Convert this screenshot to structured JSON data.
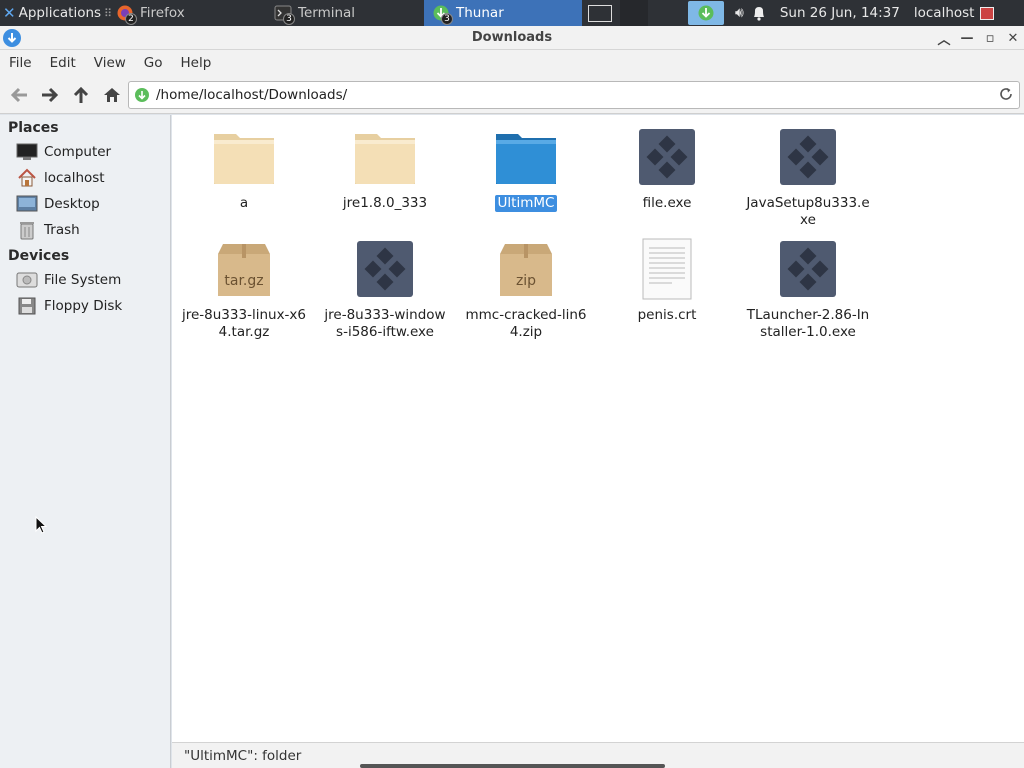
{
  "panel": {
    "apps_label": "Applications",
    "tasks": [
      {
        "label": "Firefox",
        "badge": "2",
        "active": false
      },
      {
        "label": "Terminal",
        "badge": "3",
        "active": false
      },
      {
        "label": "Thunar",
        "badge": "3",
        "active": true
      }
    ],
    "clock": "Sun 26 Jun, 14:37",
    "user": "localhost"
  },
  "window": {
    "title": "Downloads"
  },
  "menu": [
    "File",
    "Edit",
    "View",
    "Go",
    "Help"
  ],
  "location": {
    "path": "/home/localhost/Downloads/"
  },
  "sidebar": {
    "places_heading": "Places",
    "places": [
      {
        "label": "Computer",
        "icon": "monitor-icon"
      },
      {
        "label": "localhost",
        "icon": "home-icon"
      },
      {
        "label": "Desktop",
        "icon": "desktop-icon"
      },
      {
        "label": "Trash",
        "icon": "trash-icon"
      }
    ],
    "devices_heading": "Devices",
    "devices": [
      {
        "label": "File System",
        "icon": "harddisk-icon"
      },
      {
        "label": "Floppy Disk",
        "icon": "floppy-icon"
      }
    ]
  },
  "files": [
    {
      "name": "a",
      "type": "folder"
    },
    {
      "name": "jre1.8.0_333",
      "type": "folder"
    },
    {
      "name": "UltimMC",
      "type": "folder-selected",
      "selected": true
    },
    {
      "name": "file.exe",
      "type": "exe"
    },
    {
      "name": "JavaSetup8u333.exe",
      "type": "exe"
    },
    {
      "name": "jre-8u333-linux-x64.tar.gz",
      "type": "archive",
      "archive_label": "tar.gz"
    },
    {
      "name": "jre-8u333-windows-i586-iftw.exe",
      "type": "exe"
    },
    {
      "name": "mmc-cracked-lin64.zip",
      "type": "archive",
      "archive_label": "zip"
    },
    {
      "name": "penis.crt",
      "type": "text"
    },
    {
      "name": "TLauncher-2.86-Installer-1.0.exe",
      "type": "exe"
    }
  ],
  "status": {
    "text": "\"UltimMC\": folder"
  },
  "colors": {
    "accent": "#3d8ee0",
    "panel_bg": "#2e3136",
    "active_task": "#3d72b8",
    "folder": "#f3deb6",
    "folder_selected": "#2f8fd6",
    "exe": "#4f5a70"
  }
}
